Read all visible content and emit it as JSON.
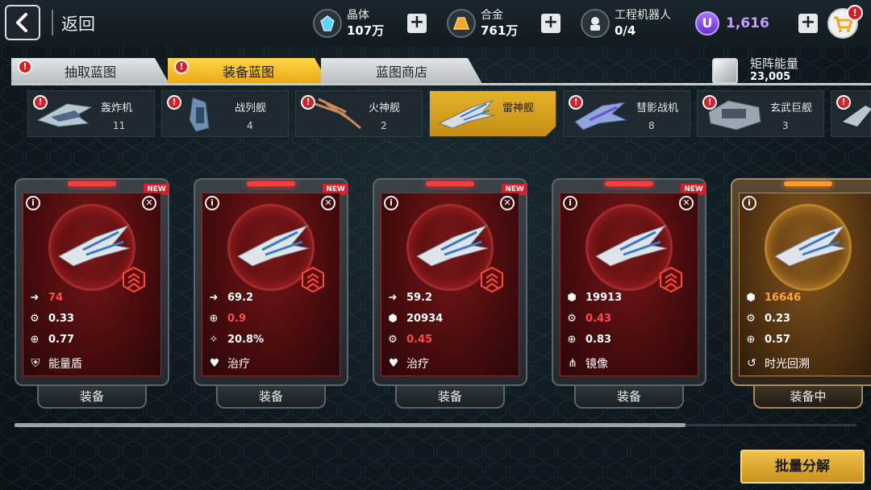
{
  "header": {
    "back_label": "返回",
    "resources": [
      {
        "icon": "crystal-icon",
        "name": "晶体",
        "value": "107万"
      },
      {
        "icon": "alloy-icon",
        "name": "合金",
        "value": "761万"
      },
      {
        "icon": "robot-icon",
        "name": "工程机器人",
        "value": "0/4"
      }
    ],
    "premium_coin": {
      "icon": "u-coin-icon",
      "symbol": "U",
      "value": "1,616",
      "color": "#c79cff"
    },
    "cart_badge": "!"
  },
  "tabs": [
    {
      "label": "抽取蓝图",
      "active": false
    },
    {
      "label": "装备蓝图",
      "active": true
    },
    {
      "label": "蓝图商店",
      "active": false
    }
  ],
  "matrix_energy": {
    "label": "矩阵能量",
    "value": "23,005"
  },
  "ship_types": [
    {
      "label": "轰炸机",
      "count": "11",
      "selected": false
    },
    {
      "label": "战列舰",
      "count": "4",
      "selected": false
    },
    {
      "label": "火神舰",
      "count": "2",
      "selected": false
    },
    {
      "label": "雷神舰",
      "count": "",
      "selected": true
    },
    {
      "label": "彗影战机",
      "count": "8",
      "selected": false
    },
    {
      "label": "玄武巨舰",
      "count": "3",
      "selected": false
    }
  ],
  "cards": [
    {
      "is_new": true,
      "new_label": "NEW",
      "rarity": "red",
      "stats": [
        {
          "icon": "speed-arrow-icon",
          "value": "74",
          "highlight": "red"
        },
        {
          "icon": "gear-icon",
          "value": "0.33",
          "highlight": ""
        },
        {
          "icon": "crosshair-icon",
          "value": "0.77",
          "highlight": ""
        }
      ],
      "skill": {
        "icon": "shield-icon",
        "label": "能量盾"
      },
      "button": "装备"
    },
    {
      "is_new": true,
      "new_label": "NEW",
      "rarity": "red",
      "stats": [
        {
          "icon": "speed-arrow-icon",
          "value": "69.2",
          "highlight": ""
        },
        {
          "icon": "crosshair-icon",
          "value": "0.9",
          "highlight": "red"
        },
        {
          "icon": "missile-icon",
          "value": "20.8%",
          "highlight": ""
        }
      ],
      "skill": {
        "icon": "heal-icon",
        "label": "治疗"
      },
      "button": "装备"
    },
    {
      "is_new": true,
      "new_label": "NEW",
      "rarity": "red",
      "stats": [
        {
          "icon": "speed-arrow-icon",
          "value": "59.2",
          "highlight": ""
        },
        {
          "icon": "hexagon-icon",
          "value": "20934",
          "highlight": ""
        },
        {
          "icon": "gear-icon",
          "value": "0.45",
          "highlight": "red"
        }
      ],
      "skill": {
        "icon": "heal-icon",
        "label": "治疗"
      },
      "button": "装备"
    },
    {
      "is_new": true,
      "new_label": "NEW",
      "rarity": "red",
      "stats": [
        {
          "icon": "hexagon-icon",
          "value": "19913",
          "highlight": ""
        },
        {
          "icon": "gear-icon",
          "value": "0.43",
          "highlight": "red"
        },
        {
          "icon": "crosshair-icon",
          "value": "0.83",
          "highlight": ""
        }
      ],
      "skill": {
        "icon": "mirror-icon",
        "label": "镜像"
      },
      "button": "装备"
    },
    {
      "is_new": false,
      "new_label": "",
      "rarity": "gold",
      "stats": [
        {
          "icon": "hexagon-icon",
          "value": "16646",
          "highlight": "orange"
        },
        {
          "icon": "gear-icon",
          "value": "0.23",
          "highlight": ""
        },
        {
          "icon": "crosshair-icon",
          "value": "0.57",
          "highlight": ""
        }
      ],
      "skill": {
        "icon": "time-rewind-icon",
        "label": "时光回溯"
      },
      "button": "装备中"
    }
  ],
  "bottom": {
    "decompose_label": "批量分解"
  },
  "colors": {
    "accent_gold": "#e7a913",
    "stat_red": "#ff4a4a",
    "stat_orange": "#ffa43a",
    "alert_red": "#d8202a"
  }
}
